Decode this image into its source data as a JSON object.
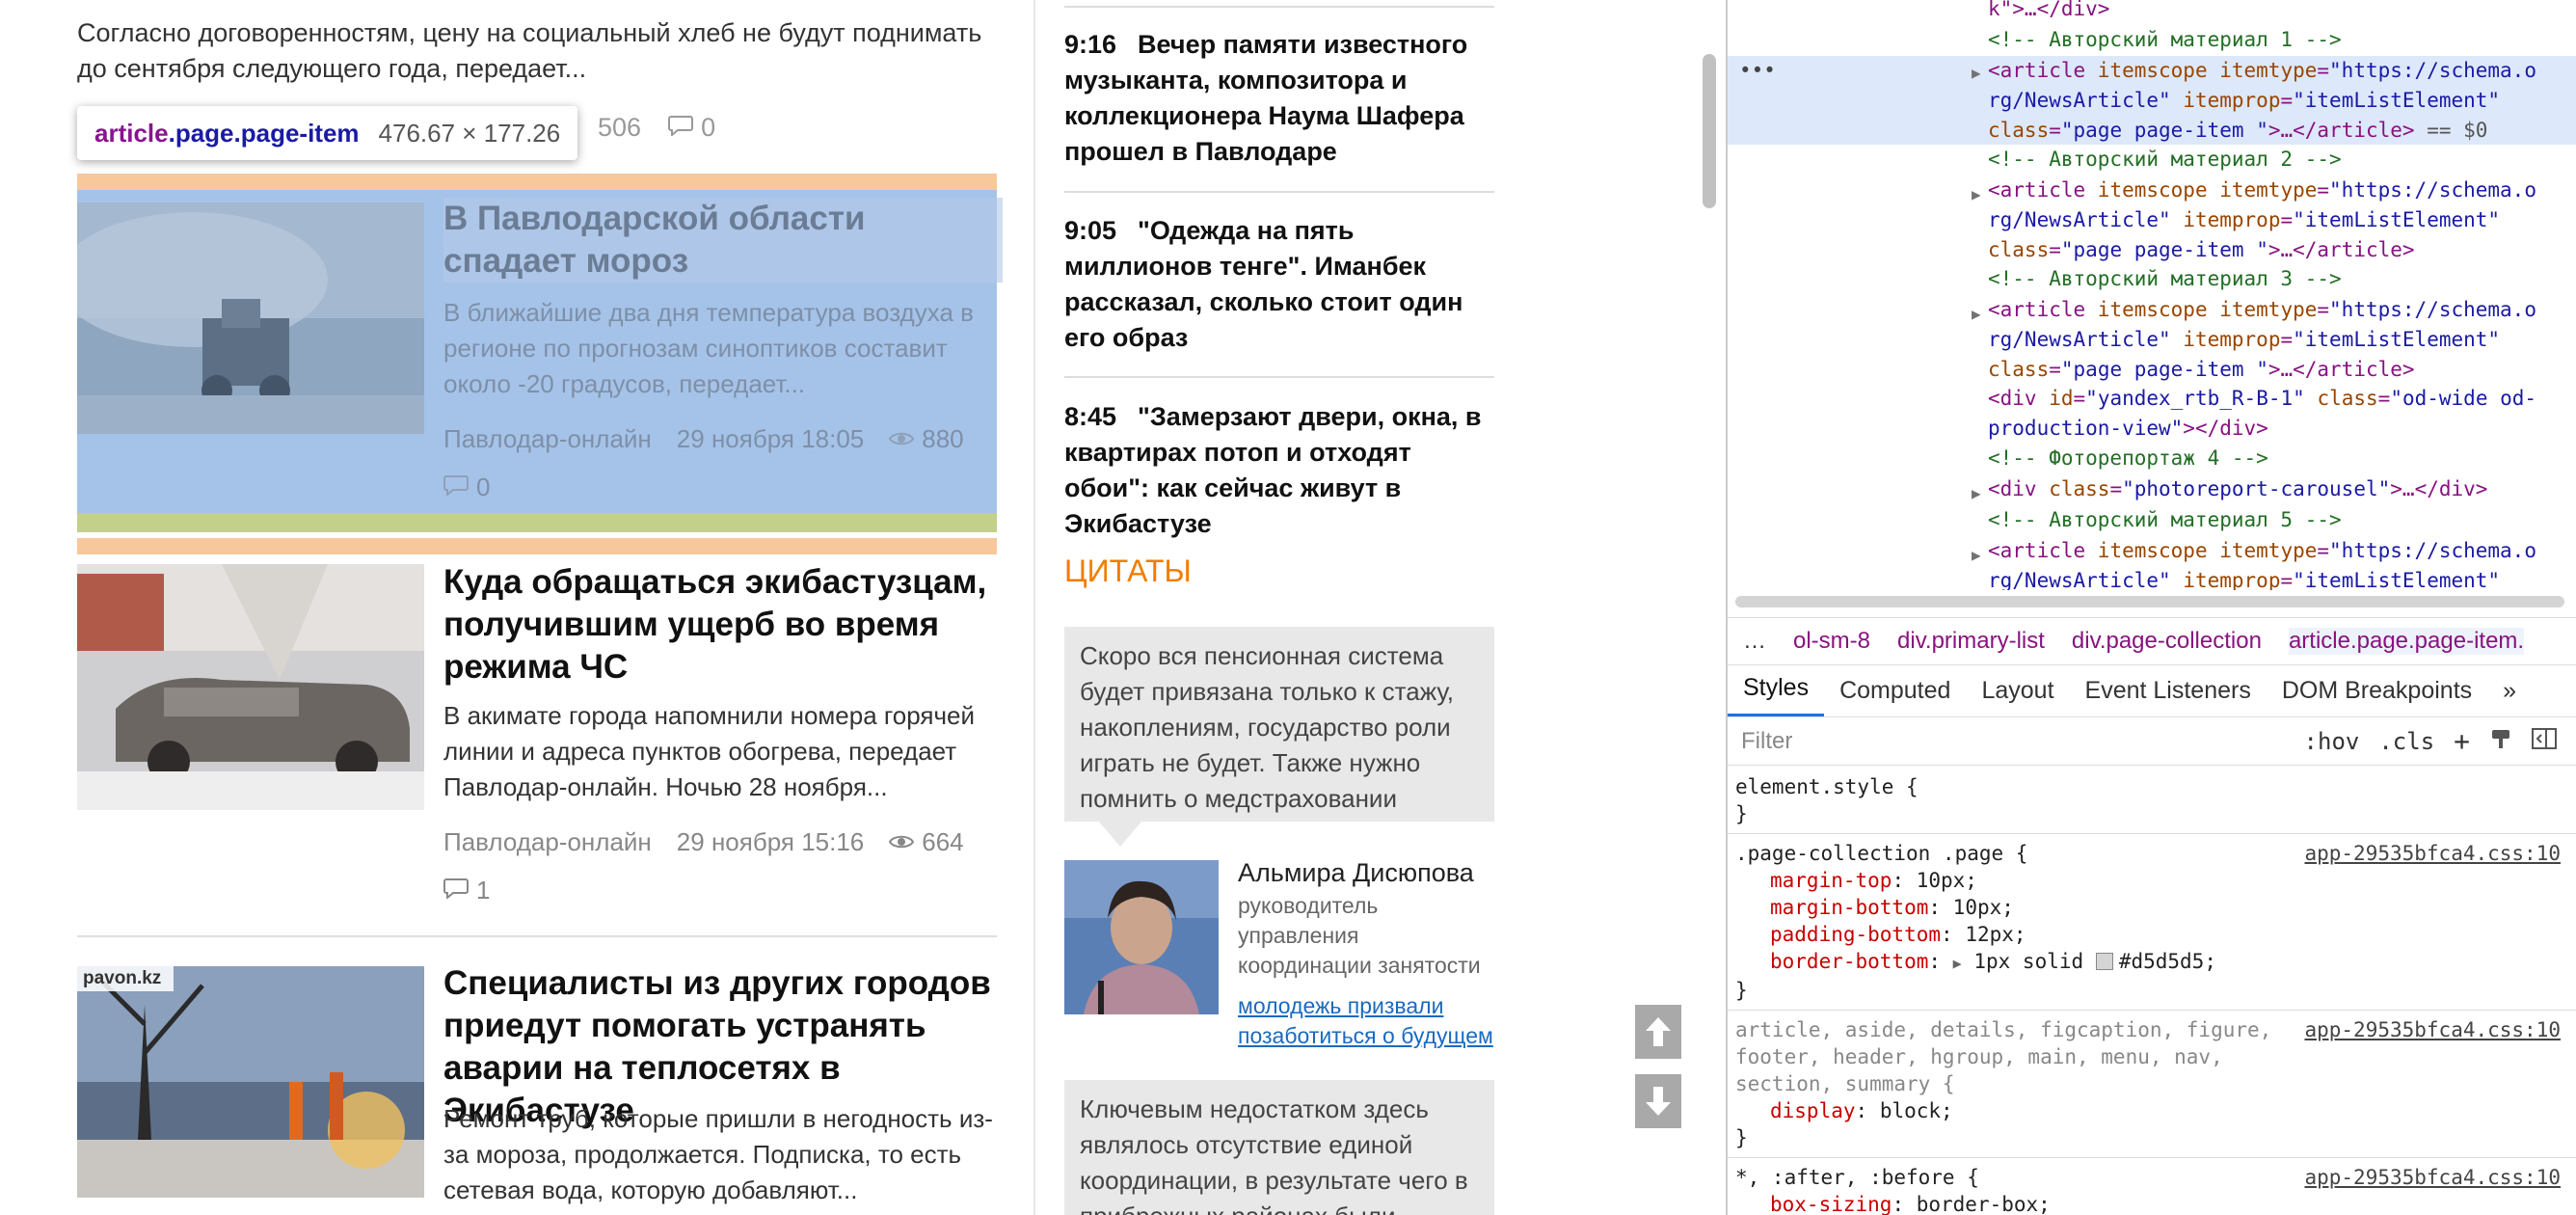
{
  "left": {
    "lead_text": "Согласно договоренностям, цену на социальный хлеб не будут поднимать до сентября следующего года, передает...",
    "lead_views": "506",
    "lead_comments": "0",
    "tooltip": {
      "selector_tag": "article",
      "selector_classes": ".page.page-item",
      "size": "476.67 × 177.26"
    },
    "articles": [
      {
        "title": "В Павлодарской области спадает мороз",
        "desc": "В ближайшие два дня температура воздуха в регионе по прогнозам синоптиков составит около -20 градусов, передает...",
        "source": "Павлодар-онлайн",
        "date": "29 ноября 18:05",
        "views": "880",
        "comments": "0"
      },
      {
        "title": "Куда обращаться экибастузцам, получившим ущерб во время режима ЧС",
        "desc": "В акимате города напомнили номера горячей линии и адреса пунктов обогрева, передает Павлодар-онлайн. Ночью 28 ноября...",
        "source": "Павлодар-онлайн",
        "date": "29 ноября 15:16",
        "views": "664",
        "comments": "1"
      },
      {
        "title": "Специалисты из других городов приедут помогать устранять аварии на теплосетях в Экибастузе",
        "desc": "Ремонт труб, которые пришли в негодность из-за мороза, продолжается. Подписка, то есть сетевая вода, которую добавляют...",
        "logo": "pavon.kz"
      }
    ]
  },
  "middle": {
    "news": [
      {
        "time": "9:16",
        "title": "Вечер памяти известного музыканта, композитора и коллекционера Наума Шафера прошел в Павлодаре"
      },
      {
        "time": "9:05",
        "title": "\"Одежда на пять миллионов тенге\". Иманбек рассказал, сколько стоит один его образ"
      },
      {
        "time": "8:45",
        "title": "\"Замерзают двери, окна, в квартирах потоп и отходят обои\": как сейчас живут в Экибастузе"
      }
    ],
    "quotes_heading": "ЦИТАТЫ",
    "quote1": "Скоро вся пенсионная система будет привязана только к стажу, накоплениям, государство роли играть не будет. Также нужно помнить о медстраховании",
    "author": {
      "name": "Альмира Дисюпова",
      "role": "руководитель управления координации занятости",
      "link": "молодежь призвали позаботиться о будущем"
    },
    "quote2": "Ключевым недостатком здесь являлось отсутствие единой координации, в результате чего в прибрежных районах были"
  },
  "devtools": {
    "code_lines": [
      {
        "kind": "tagtail",
        "text": "k\">…</div>"
      },
      {
        "kind": "comment",
        "text": "<!-- Авторский материал 1 -->"
      },
      {
        "kind": "article",
        "cls": "page page-item  ",
        "selected": true,
        "suffix": " == $0"
      },
      {
        "kind": "comment",
        "text": "<!-- Авторский материал 2 -->"
      },
      {
        "kind": "article",
        "cls": "page page-item  "
      },
      {
        "kind": "comment",
        "text": "<!-- Авторский материал 3 -->"
      },
      {
        "kind": "article",
        "cls": "page page-item  "
      },
      {
        "kind": "div",
        "text": "yandex_rtb_R-B-1"
      },
      {
        "kind": "comment",
        "text": "<!-- Фоторепортаж 4 -->"
      },
      {
        "kind": "carousel",
        "text": "photoreport-carousel"
      },
      {
        "kind": "comment",
        "text": "<!-- Авторский материал 5 -->"
      },
      {
        "kind": "article_partial"
      }
    ],
    "article_open": "<article itemscope itemtype=\"https://schema.o",
    "article_open2": "rg/NewsArticle\" itemprop=\"itemListElement\"",
    "crumbs": [
      "…",
      "ol-sm-8",
      "div.primary-list",
      "div.page-collection",
      "article.page.page-item."
    ],
    "tabs": [
      "Styles",
      "Computed",
      "Layout",
      "Event Listeners",
      "DOM Breakpoints",
      "»"
    ],
    "filter_placeholder": "Filter",
    "filter_hov": ":hov",
    "filter_cls": ".cls",
    "rules": {
      "r1_sel": "element.style {",
      "r2_sel": ".page-collection .page {",
      "r2_src": "app-29535bfca4.css:10",
      "r2_props": [
        [
          "margin-top",
          "10px;"
        ],
        [
          "margin-bottom",
          "10px;"
        ],
        [
          "padding-bottom",
          "12px;"
        ]
      ],
      "r2_border_name": "border-bottom",
      "r2_border_val": "1px solid",
      "r2_border_color": "#d5d5d5;",
      "r3_sel": "article, aside, details, figcaption, figure, footer, header, hgroup, main, menu, nav, section, summary {",
      "r3_src": "app-29535bfca4.css:10",
      "r3_prop": [
        "display",
        "block;"
      ],
      "r4_sel": "*, :after, :before {",
      "r4_src": "app-29535bfca4.css:10",
      "r4_prop": [
        "box-sizing",
        "border-box;"
      ]
    }
  }
}
